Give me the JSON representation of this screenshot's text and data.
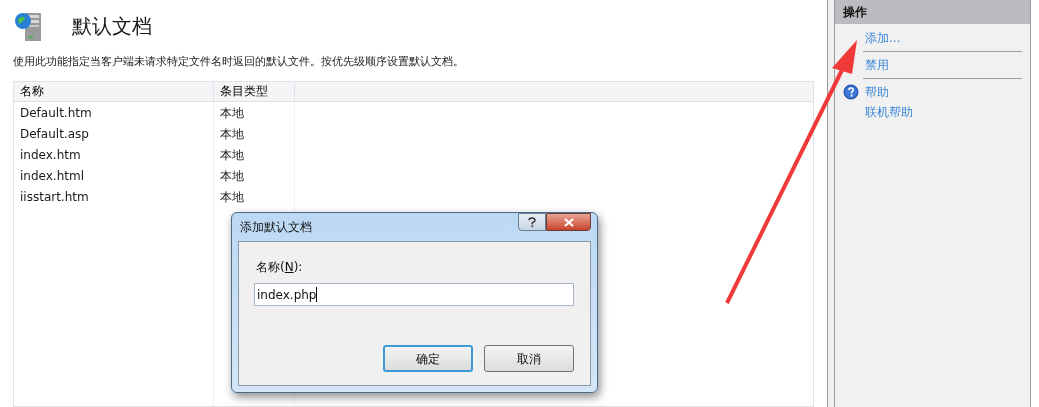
{
  "page": {
    "title": "默认文档",
    "description": "使用此功能指定当客户端未请求特定文件名时返回的默认文件。按优先级顺序设置默认文档。"
  },
  "table": {
    "columns": [
      "名称",
      "条目类型"
    ],
    "rows": [
      {
        "name": "Default.htm",
        "type": "本地"
      },
      {
        "name": "Default.asp",
        "type": "本地"
      },
      {
        "name": "index.htm",
        "type": "本地"
      },
      {
        "name": "index.html",
        "type": "本地"
      },
      {
        "name": "iisstart.htm",
        "type": "本地"
      }
    ]
  },
  "actions": {
    "title": "操作",
    "items": [
      {
        "kind": "link",
        "label": "添加..."
      },
      {
        "kind": "separator"
      },
      {
        "kind": "link",
        "label": "禁用"
      },
      {
        "kind": "separator"
      },
      {
        "kind": "help",
        "label": "帮助"
      },
      {
        "kind": "link",
        "label": "联机帮助"
      }
    ]
  },
  "dialog": {
    "title": "添加默认文档",
    "label_before": "名称(",
    "access_key": "N",
    "label_after": "):",
    "value": "index.php",
    "buttons": [
      {
        "label": "确定",
        "default": true
      },
      {
        "label": "取消",
        "default": false
      }
    ]
  },
  "annotation": {
    "kind": "arrow"
  }
}
